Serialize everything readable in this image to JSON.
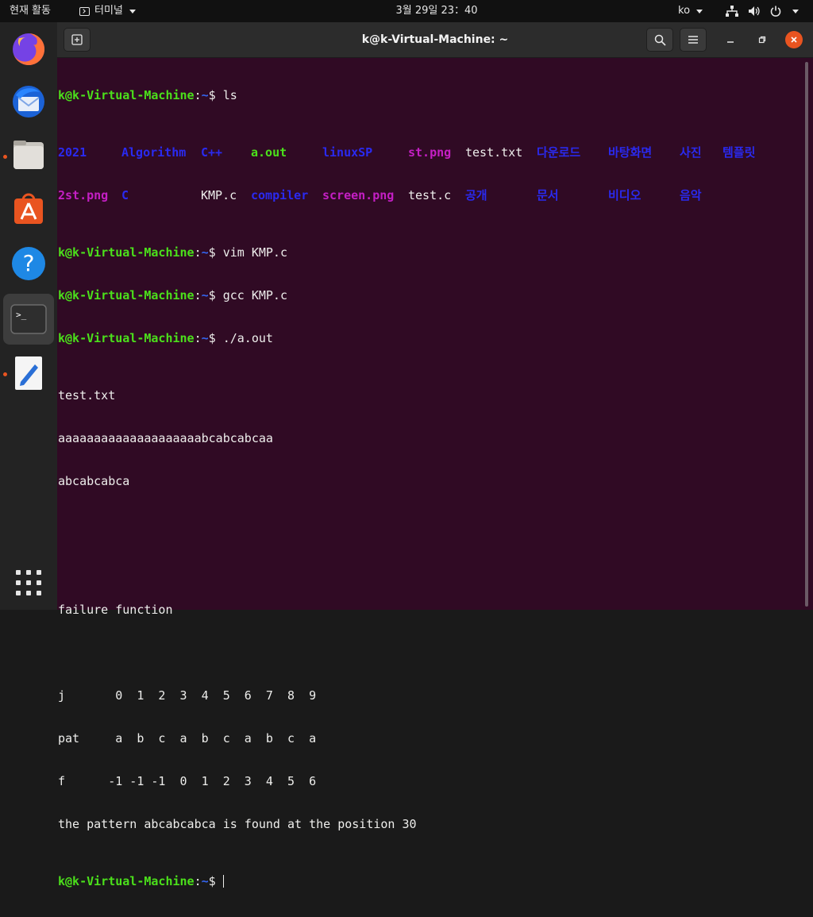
{
  "topbar": {
    "activities": "현재 활동",
    "app_name": "터미널",
    "clock": "3월 29일  23：40",
    "input_lang": "ko"
  },
  "dock": {
    "items": [
      {
        "name": "firefox",
        "running": false
      },
      {
        "name": "thunderbird",
        "running": false
      },
      {
        "name": "files",
        "running": true
      },
      {
        "name": "software",
        "running": false
      },
      {
        "name": "help",
        "running": false
      },
      {
        "name": "terminal",
        "running": true,
        "active": true
      },
      {
        "name": "text-editor",
        "running": true
      }
    ]
  },
  "window": {
    "title": "k@k-Virtual-Machine: ~"
  },
  "terminal": {
    "prompt_user": "k@k-Virtual-Machine",
    "prompt_path": "~",
    "prompt_sign": "$ ",
    "cmd_ls": "ls",
    "ls_row1": [
      {
        "text": "2021",
        "kind": "dir"
      },
      {
        "text": "Algorithm",
        "kind": "dir"
      },
      {
        "text": "C++",
        "kind": "dir"
      },
      {
        "text": "a.out",
        "kind": "exec"
      },
      {
        "text": "linuxSP",
        "kind": "dir"
      },
      {
        "text": "st.png",
        "kind": "img"
      },
      {
        "text": "test.txt",
        "kind": "file"
      },
      {
        "text": "다운로드",
        "kind": "dir"
      },
      {
        "text": "바탕화면",
        "kind": "dir"
      },
      {
        "text": "사진",
        "kind": "dir"
      },
      {
        "text": "템플릿",
        "kind": "dir"
      }
    ],
    "ls_row2": [
      {
        "text": "2st.png",
        "kind": "img"
      },
      {
        "text": "C",
        "kind": "dir"
      },
      {
        "text": "KMP.c",
        "kind": "file"
      },
      {
        "text": "compiler",
        "kind": "dir"
      },
      {
        "text": "screen.png",
        "kind": "img"
      },
      {
        "text": "test.c",
        "kind": "file"
      },
      {
        "text": "공개",
        "kind": "dir"
      },
      {
        "text": "문서",
        "kind": "dir"
      },
      {
        "text": "비디오",
        "kind": "dir"
      },
      {
        "text": "음악",
        "kind": "dir"
      }
    ],
    "cmd_vim": "vim KMP.c",
    "cmd_gcc": "gcc KMP.c",
    "cmd_run": "./a.out",
    "output": [
      "test.txt",
      "aaaaaaaaaaaaaaaaaaaabcabcabcaa",
      "abcabcabca",
      "",
      "",
      "failure function",
      "",
      "j       0  1  2  3  4  5  6  7  8  9",
      "pat     a  b  c  a  b  c  a  b  c  a",
      "f      -1 -1 -1  0  1  2  3  4  5  6",
      "the pattern abcabcabca is found at the position 30"
    ]
  },
  "colors": {
    "terminal_bg": "#300a24",
    "prompt_user": "#4be01b",
    "prompt_path": "#3465f0",
    "accent": "#e95420"
  }
}
